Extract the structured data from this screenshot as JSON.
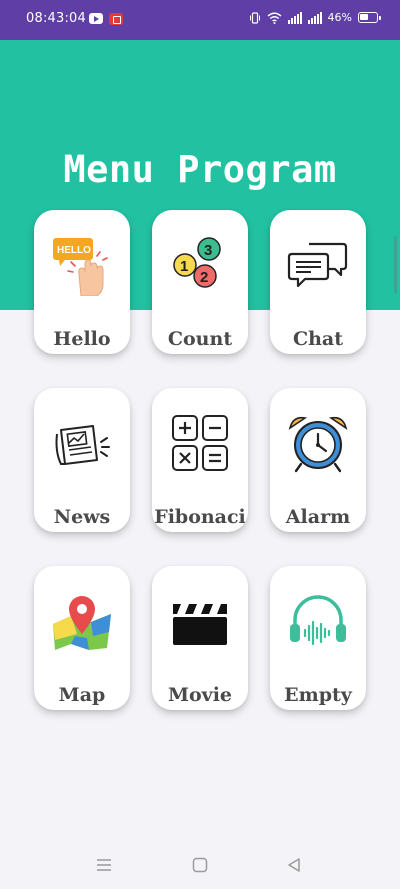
{
  "status_bar": {
    "time": "08:43:04",
    "battery_text": "46%",
    "icons": [
      "youtube-icon",
      "screen-record-icon",
      "vibrate-icon",
      "wifi-icon",
      "signal-icon",
      "signal-icon",
      "battery-icon"
    ]
  },
  "header": {
    "title": "Menu Program",
    "background_color": "#22c1a1"
  },
  "menu": {
    "items": [
      {
        "label": "Hello",
        "icon": "hello-hand-icon"
      },
      {
        "label": "Count",
        "icon": "count-bubbles-icon"
      },
      {
        "label": "Chat",
        "icon": "chat-bubbles-icon"
      },
      {
        "label": "News",
        "icon": "newspaper-icon"
      },
      {
        "label": "Fibonaci",
        "icon": "calculator-icon"
      },
      {
        "label": "Alarm",
        "icon": "alarm-clock-icon"
      },
      {
        "label": "Map",
        "icon": "map-pin-icon"
      },
      {
        "label": "Movie",
        "icon": "clapperboard-icon"
      },
      {
        "label": "Empty",
        "icon": "headphones-icon"
      }
    ]
  },
  "nav_bar": {
    "buttons": [
      "menu-icon",
      "home-icon",
      "back-icon"
    ]
  }
}
